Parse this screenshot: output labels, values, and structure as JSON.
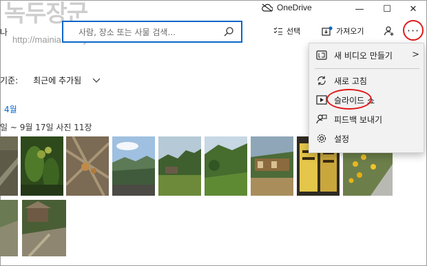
{
  "watermark": {
    "title": "녹두장군",
    "url": "http://mainia.tistory.com"
  },
  "titlebar": {
    "service": "OneDrive",
    "minimize": "—",
    "maximize": "☐",
    "close": "✕"
  },
  "search": {
    "placeholder": "사람, 장소 또는 사물 검색...",
    "left_crop": "나"
  },
  "toolbar": {
    "select_label": "선택",
    "import_label": "가져오기",
    "more_label": "···"
  },
  "sort": {
    "label": "기준:",
    "value": "최근에 추가됨"
  },
  "month": "4월",
  "date_range": "일 ~ 9월 17일   사진 11장",
  "menu": {
    "items": [
      {
        "label": "새 비디오 만들기",
        "icon": "video-editor-icon"
      },
      {
        "label": "새로 고침",
        "icon": "refresh-icon"
      },
      {
        "label": "슬라이드 쇼",
        "icon": "slideshow-icon"
      },
      {
        "label": "피드백 보내기",
        "icon": "feedback-icon"
      },
      {
        "label": "설정",
        "icon": "settings-gear-icon"
      }
    ],
    "submenu_arrow": ">"
  }
}
